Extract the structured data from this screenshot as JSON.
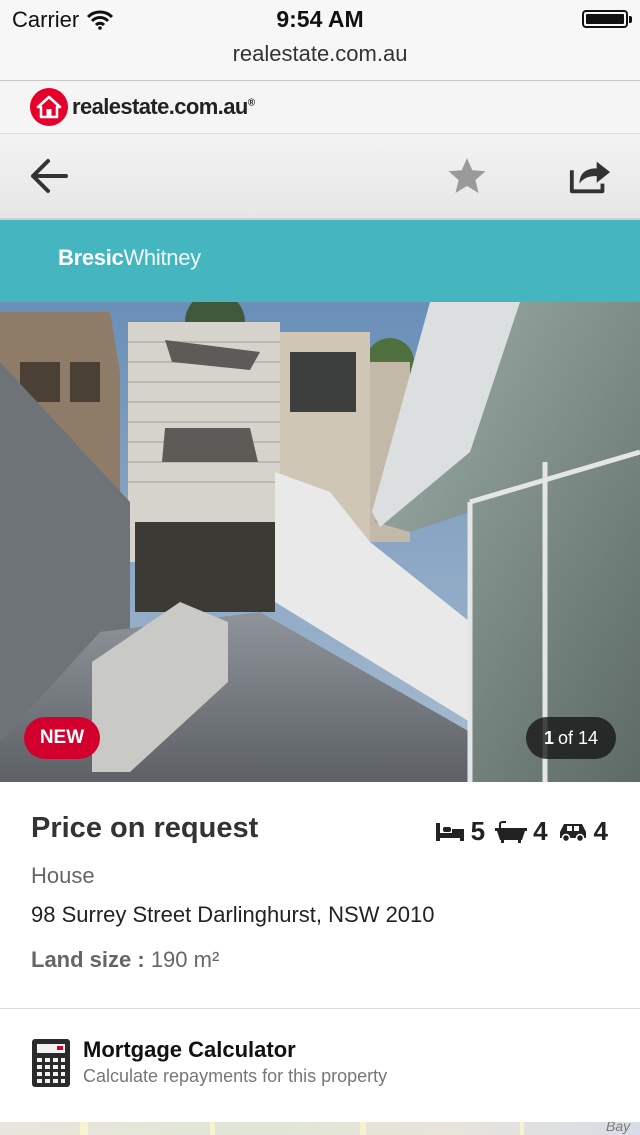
{
  "status_bar": {
    "carrier": "Carrier",
    "time": "9:54 AM",
    "url": "realestate.com.au"
  },
  "site": {
    "logo_text": "realestate.com.au",
    "logo_registered": "®",
    "brand_color": "#e4002b"
  },
  "toolbar": {
    "back_icon": "arrow-left-icon",
    "favourite_icon": "star-icon",
    "share_icon": "share-icon"
  },
  "agency": {
    "name_bold": "Bresic",
    "name_light": "Whitney",
    "banner_color": "#45b5bf"
  },
  "gallery": {
    "badge": "NEW",
    "current": "1",
    "of_total": "of 14"
  },
  "listing": {
    "price": "Price on request",
    "bedrooms": "5",
    "bathrooms": "4",
    "car_spaces": "4",
    "property_type": "House",
    "address": "98 Surrey Street Darlinghurst, NSW 2010",
    "land_size_label": "Land size :",
    "land_size_value": "190 m²"
  },
  "mortgage": {
    "title": "Mortgage Calculator",
    "subtitle": "Calculate repayments for this property"
  },
  "map": {
    "label": "Bay"
  }
}
